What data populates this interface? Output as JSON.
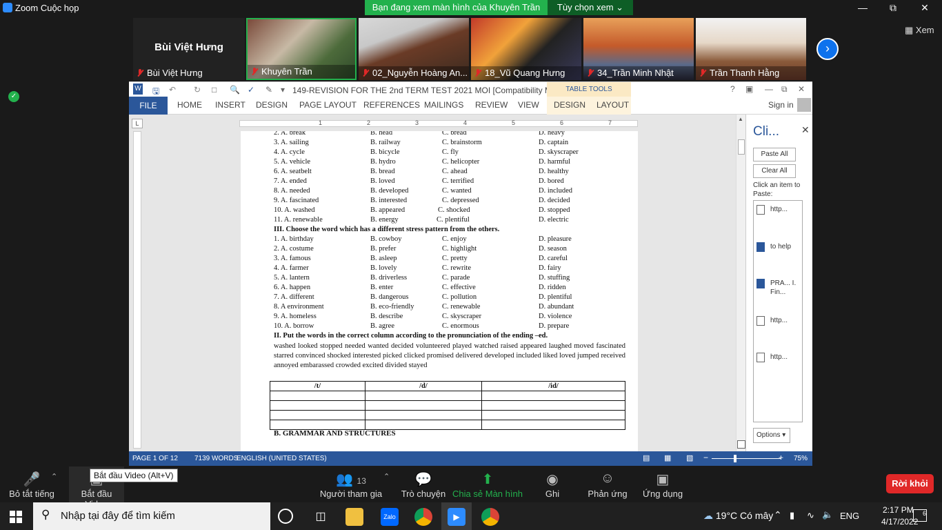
{
  "app": {
    "title": "Zoom Cuộc họp",
    "share_banner": "Bạn đang xem màn hình của Khuyên Trần",
    "view_options": "Tùy chọn xem ⌄",
    "view_toggle": "Xem"
  },
  "participants": {
    "main_name": "Bùi Việt Hưng",
    "thumbs": [
      {
        "name": "Bùi Việt Hưng"
      },
      {
        "name": "Khuyên Trần"
      },
      {
        "name": "02_Nguyễn Hoàng An..."
      },
      {
        "name": "18_Vũ Quang Hưng"
      },
      {
        "name": "34_Trần Minh Nhật"
      },
      {
        "name": "Trần Thanh Hằng"
      }
    ]
  },
  "word": {
    "doc_title": "149-REVISION FOR THE 2nd TERM TEST 2021 MOI [Compatibility M...",
    "table_tools": "TABLE TOOLS",
    "tabs": [
      "FILE",
      "HOME",
      "INSERT",
      "DESIGN",
      "PAGE LAYOUT",
      "REFERENCES",
      "MAILINGS",
      "REVIEW",
      "VIEW",
      "DESIGN",
      "LAYOUT"
    ],
    "signin": "Sign in",
    "ruler_corner": "L",
    "ruler_nums": [
      "1",
      "2",
      "3",
      "4",
      "5",
      "6",
      "7"
    ],
    "pron_rows": [
      [
        "2.  A. break",
        "B. head",
        "C. bread",
        "D. heavy"
      ],
      [
        "3.  A. sailing",
        "B. railway",
        "C. brainstorm",
        "D. captain"
      ],
      [
        "4.  A. cycle",
        "B. bicycle",
        "C. fly",
        "D. skyscraper"
      ],
      [
        "5.  A.  vehicle",
        "B. hydro",
        "C.  helicopter",
        "D. harmful"
      ],
      [
        "6. A.  seatbelt",
        "B.  bread",
        "C.  ahead",
        "D.  healthy"
      ],
      [
        "7.  A. ended",
        "B. loved",
        "C. terrified",
        "D. bored"
      ],
      [
        "8.  A. needed",
        "B. developed",
        "C. wanted",
        "D. included"
      ],
      [
        "9.  A. fascinated",
        "B. interested",
        "C. depressed",
        "D. decided"
      ],
      [
        "10.  A. washed",
        "B. appeared",
        "C. shocked",
        "D. stopped"
      ],
      [
        "11.  A. renewable",
        "B. energy",
        "C. plentiful",
        "D. electric"
      ]
    ],
    "heading_stress": "III. Choose the word which has a different stress pattern from the others.",
    "stress_rows": [
      [
        "1.  A. birthday",
        "B. cowboy",
        "C. enjoy",
        "D. pleasure"
      ],
      [
        "2.  A. costume",
        "B. prefer",
        "C. highlight",
        "D. season"
      ],
      [
        "3.  A. famous",
        "B. asleep",
        "C. pretty",
        "D. careful"
      ],
      [
        "4.  A. farmer",
        "B. lovely",
        "C. rewrite",
        "D. fairy"
      ],
      [
        "5. A. lantern",
        "B. driverless",
        "C. parade",
        "D. stuffing"
      ],
      [
        "6. A. happen",
        "B. enter",
        "C. effective",
        "D. ridden"
      ],
      [
        "7. A. different",
        "B. dangerous",
        "C. pollution",
        "D. plentiful"
      ],
      [
        "8. A environment",
        "B. eco-friendly",
        "C. renewable",
        "D. abundant"
      ],
      [
        "9. A. homeless",
        "B. describe",
        "C. skyscraper",
        "D. violence"
      ],
      [
        "10. A. borrow",
        "B. agree",
        "C. enormous",
        "D. prepare"
      ]
    ],
    "heading_endings": "II. Put the words in the correct column according to the pronunciation of the ending –ed.",
    "ed_words": "washed looked stopped needed wanted decided volunteered played watched raised appeared laughed moved fascinated starred convinced shocked interested picked clicked promised delivered developed included liked loved jumped received annoyed embarassed crowded excited divided stayed",
    "table_headers": [
      "/t/",
      "/d/",
      "/id/"
    ],
    "section_b": "B. GRAMMAR AND STRUCTURES",
    "clipboard": {
      "title": "Cli...",
      "paste_all": "Paste All",
      "clear_all": "Clear All",
      "hint": "Click an item to Paste:",
      "items": [
        "http...",
        "to help",
        "PRA... I. Fin...",
        "http...",
        "http..."
      ],
      "options": "Options ▾"
    },
    "status": {
      "page": "PAGE 1 OF 12",
      "words": "7139 WORDS",
      "language": "ENGLISH (UNITED STATES)",
      "zoom": "75%"
    }
  },
  "zoom_toolbar": {
    "mute": "Bỏ tắt tiếng",
    "video": "Bắt đầu Video",
    "video_tooltip": "Bắt đầu Video (Alt+V)",
    "participants": "Người tham gia",
    "participants_count": "13",
    "chat": "Trò chuyện",
    "share": "Chia sẻ Màn hình",
    "record": "Ghi",
    "reactions": "Phản ứng",
    "apps": "Ứng dụng",
    "leave": "Rời khỏi"
  },
  "taskbar": {
    "search_placeholder": "Nhập tại đây để tìm kiếm",
    "weather": "19°C  Có mây",
    "language": "ENG",
    "time": "2:17 PM",
    "date": "4/17/2022",
    "notifications": "6"
  },
  "colors": {
    "zoom_green": "#23b14d",
    "word_blue": "#2b579a",
    "leave_red": "#e02828",
    "zoom_blue": "#0e72ed"
  }
}
